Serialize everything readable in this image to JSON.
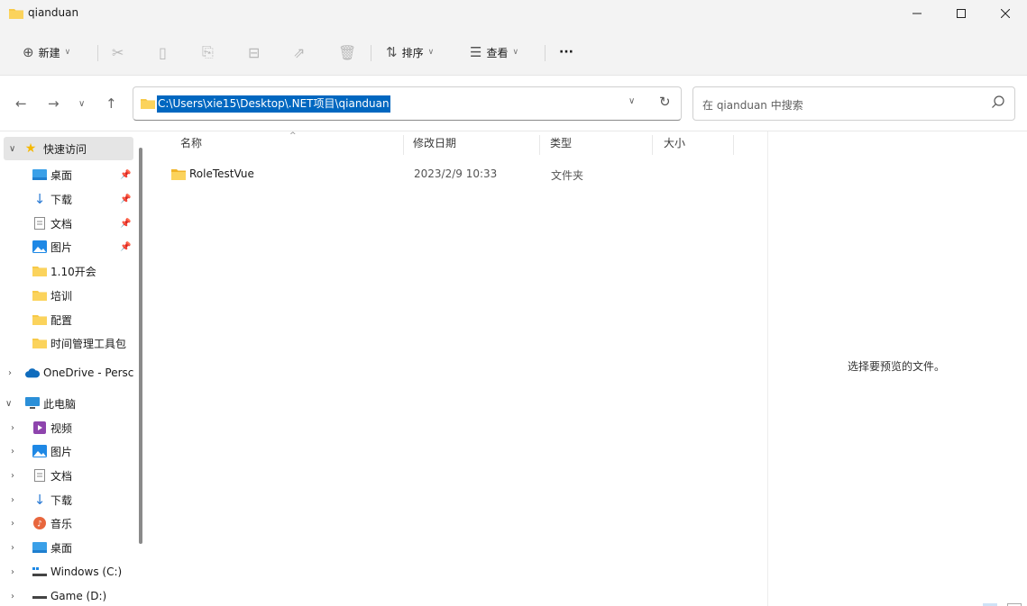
{
  "window": {
    "title": "qianduan"
  },
  "toolbar": {
    "new_label": "新建",
    "sort_label": "排序",
    "view_label": "查看",
    "more_label": "···"
  },
  "address": {
    "path": "C:\\Users\\xie15\\Desktop\\.NET项目\\qianduan"
  },
  "search": {
    "placeholder": "在 qianduan 中搜索"
  },
  "sidebar": {
    "items": [
      {
        "label": "快速访问",
        "icon": "star-icon"
      },
      {
        "label": "桌面",
        "icon": "desktop-icon",
        "pinned": true
      },
      {
        "label": "下载",
        "icon": "download-icon",
        "pinned": true
      },
      {
        "label": "文档",
        "icon": "document-icon",
        "pinned": true
      },
      {
        "label": "图片",
        "icon": "pictures-icon",
        "pinned": true
      },
      {
        "label": "1.10开会",
        "icon": "folder-icon"
      },
      {
        "label": "培训",
        "icon": "folder-icon"
      },
      {
        "label": "配置",
        "icon": "folder-icon"
      },
      {
        "label": "时间管理工具包",
        "icon": "folder-icon"
      },
      {
        "label": "OneDrive - Persc",
        "icon": "cloud-icon"
      },
      {
        "label": "此电脑",
        "icon": "computer-icon"
      },
      {
        "label": "视频",
        "icon": "video-icon"
      },
      {
        "label": "图片",
        "icon": "pictures-icon"
      },
      {
        "label": "文档",
        "icon": "document-icon"
      },
      {
        "label": "下载",
        "icon": "download-icon"
      },
      {
        "label": "音乐",
        "icon": "music-icon"
      },
      {
        "label": "桌面",
        "icon": "desktop-icon"
      },
      {
        "label": "Windows (C:)",
        "icon": "drive-icon"
      },
      {
        "label": "Game (D:)",
        "icon": "drive-icon"
      }
    ]
  },
  "list": {
    "columns": [
      "名称",
      "修改日期",
      "类型",
      "大小"
    ],
    "rows": [
      {
        "name": "RoleTestVue",
        "modified": "2023/2/9 10:33",
        "type": "文件夹",
        "size": ""
      }
    ]
  },
  "preview": {
    "text": "选择要预览的文件。"
  },
  "colors": {
    "accent": "#0067c0",
    "folder": "#f7c948",
    "chrome": "#f3f3f3"
  }
}
